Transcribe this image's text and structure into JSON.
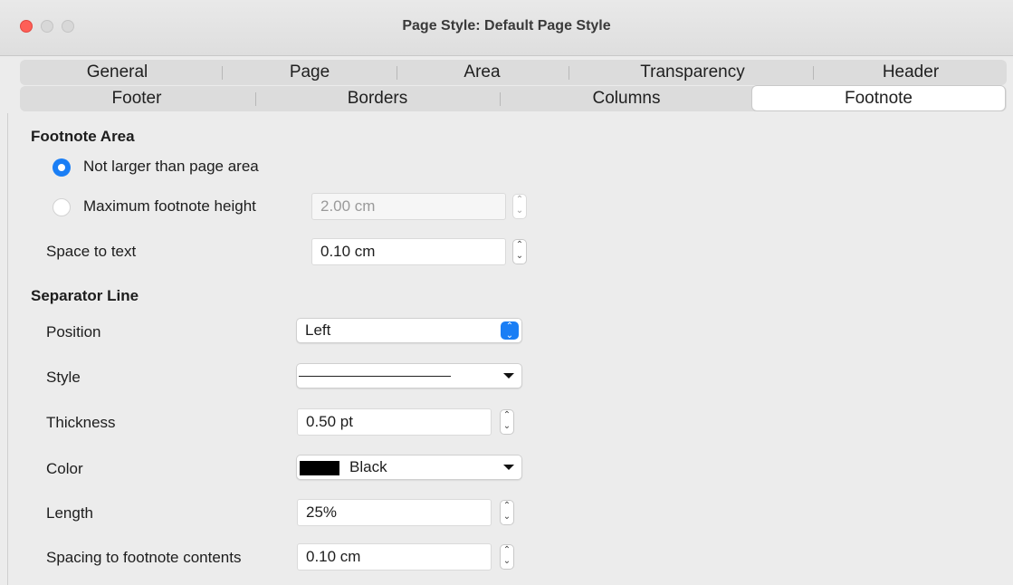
{
  "window": {
    "title": "Page Style: Default Page Style"
  },
  "tabs": {
    "row1": [
      "General",
      "Page",
      "Area",
      "Transparency",
      "Header"
    ],
    "row2": [
      "Footer",
      "Borders",
      "Columns",
      "Footnote"
    ],
    "active": "Footnote"
  },
  "footnote_area": {
    "heading": "Footnote Area",
    "option_not_larger": "Not larger than page area",
    "option_maximum": "Maximum footnote height",
    "max_height_value": "2.00 cm",
    "space_to_text_label": "Space to text",
    "space_to_text_value": "0.10 cm",
    "selected": "Not larger than page area"
  },
  "separator_line": {
    "heading": "Separator Line",
    "position_label": "Position",
    "position_value": "Left",
    "style_label": "Style",
    "thickness_label": "Thickness",
    "thickness_value": "0.50 pt",
    "color_label": "Color",
    "color_value": "Black",
    "color_hex": "#000000",
    "length_label": "Length",
    "length_value": "25%",
    "spacing_label": "Spacing to footnote contents",
    "spacing_value": "0.10 cm"
  },
  "colors": {
    "accent": "#1a7ef5",
    "close_button": "#fe5f57"
  }
}
